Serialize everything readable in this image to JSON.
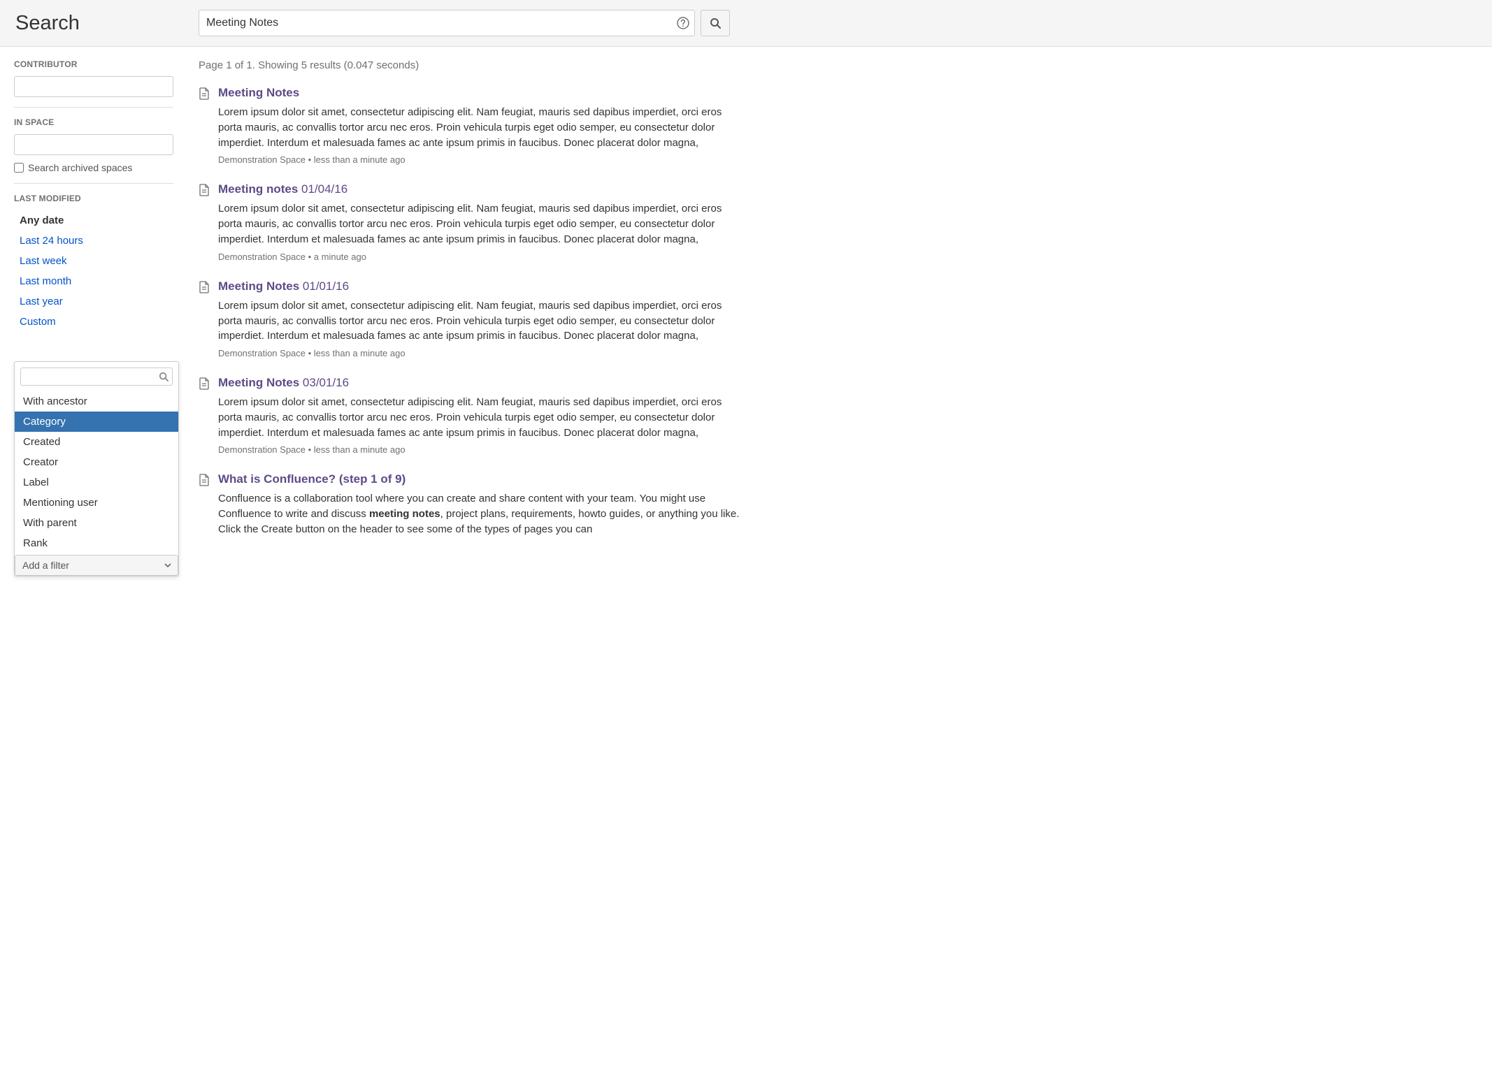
{
  "header": {
    "title": "Search",
    "query": "Meeting Notes"
  },
  "sidebar": {
    "contributor_heading": "Contributor",
    "inspace_heading": "In space",
    "archived_label": "Search archived spaces",
    "lastmod_heading": "Last Modified",
    "lastmod_items": [
      {
        "label": "Any date",
        "current": true
      },
      {
        "label": "Last 24 hours",
        "current": false
      },
      {
        "label": "Last week",
        "current": false
      },
      {
        "label": "Last month",
        "current": false
      },
      {
        "label": "Last year",
        "current": false
      },
      {
        "label": "Custom",
        "current": false
      }
    ],
    "add_filter_label": "Add a filter",
    "filter_dropdown": {
      "items": [
        {
          "label": "With ancestor",
          "selected": false
        },
        {
          "label": "Category",
          "selected": true
        },
        {
          "label": "Created",
          "selected": false
        },
        {
          "label": "Creator",
          "selected": false
        },
        {
          "label": "Label",
          "selected": false
        },
        {
          "label": "Mentioning user",
          "selected": false
        },
        {
          "label": "With parent",
          "selected": false
        },
        {
          "label": "Rank",
          "selected": false
        }
      ]
    }
  },
  "results_meta": "Page 1 of 1. Showing 5 results (0.047 seconds)",
  "results": [
    {
      "title": "Meeting Notes",
      "title_suffix": "",
      "snippet": "Lorem ipsum dolor sit amet, consectetur adipiscing elit. Nam feugiat, mauris sed dapibus imperdiet, orci eros porta mauris, ac convallis tortor arcu nec eros. Proin vehicula turpis eget odio semper, eu consectetur dolor imperdiet. Interdum et malesuada fames ac ante ipsum primis in faucibus. Donec placerat dolor magna,",
      "space": "Demonstration Space",
      "age": "less than a minute ago"
    },
    {
      "title": "Meeting notes",
      "title_suffix": " 01/04/16",
      "snippet": "Lorem ipsum dolor sit amet, consectetur adipiscing elit. Nam feugiat, mauris sed dapibus imperdiet, orci eros porta mauris, ac convallis tortor arcu nec eros. Proin vehicula turpis eget odio semper, eu consectetur dolor imperdiet. Interdum et malesuada fames ac ante ipsum primis in faucibus. Donec placerat dolor magna,",
      "space": "Demonstration Space",
      "age": "a minute ago"
    },
    {
      "title": "Meeting Notes",
      "title_suffix": " 01/01/16",
      "snippet": "Lorem ipsum dolor sit amet, consectetur adipiscing elit. Nam feugiat, mauris sed dapibus imperdiet, orci eros porta mauris, ac convallis tortor arcu nec eros. Proin vehicula turpis eget odio semper, eu consectetur dolor imperdiet. Interdum et malesuada fames ac ante ipsum primis in faucibus. Donec placerat dolor magna,",
      "space": "Demonstration Space",
      "age": "less than a minute ago"
    },
    {
      "title": "Meeting Notes",
      "title_suffix": " 03/01/16",
      "snippet": "Lorem ipsum dolor sit amet, consectetur adipiscing elit. Nam feugiat, mauris sed dapibus imperdiet, orci eros porta mauris, ac convallis tortor arcu nec eros. Proin vehicula turpis eget odio semper, eu consectetur dolor imperdiet. Interdum et malesuada fames ac ante ipsum primis in faucibus. Donec placerat dolor magna,",
      "space": "Demonstration Space",
      "age": "less than a minute ago"
    },
    {
      "title": "What is Confluence? (step 1 of 9)",
      "title_suffix": "",
      "snippet_pre": "Confluence is a collaboration tool where you can create and share content with your team. You might use Confluence to write and discuss ",
      "snippet_hl": "meeting notes",
      "snippet_post": ", project plans, requirements, howto guides, or anything you like. Click the Create button on the header to see some of the types of pages you can",
      "space": "",
      "age": ""
    }
  ]
}
